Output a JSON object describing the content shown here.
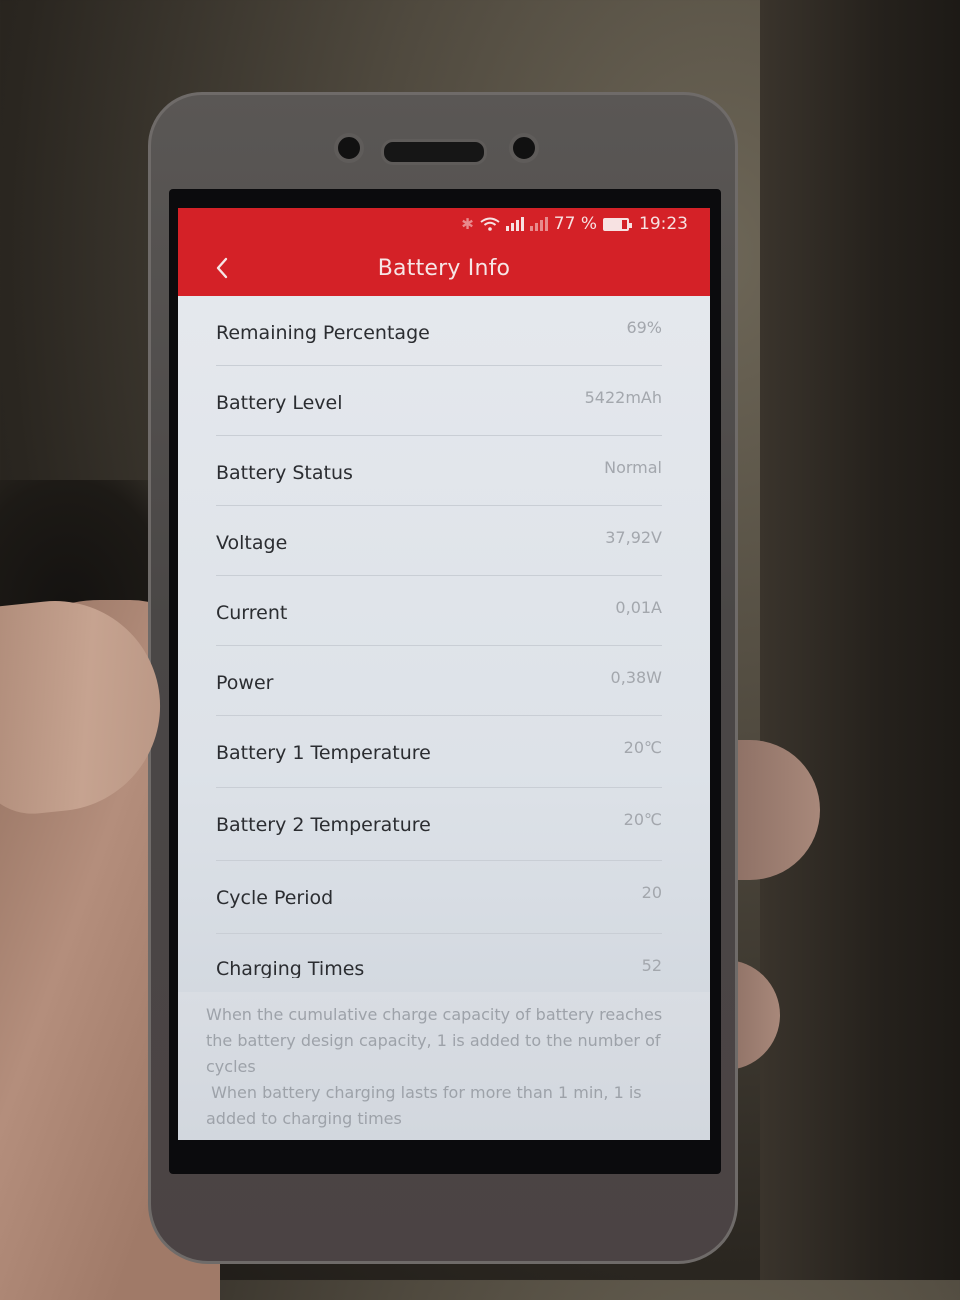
{
  "status_bar": {
    "icons": [
      "bluetooth-icon",
      "wifi-icon",
      "signal-icon",
      "signal-dim-icon",
      "battery-icon"
    ],
    "battery_percent_text": "77 %",
    "battery_level": 0.77,
    "time": "19:23"
  },
  "app_bar": {
    "back_icon": "chevron-left-icon",
    "title": "Battery Info"
  },
  "rows": [
    {
      "label": "Remaining Percentage",
      "value": "69%"
    },
    {
      "label": "Battery Level",
      "value": "5422mAh"
    },
    {
      "label": "Battery Status",
      "value": "Normal"
    },
    {
      "label": "Voltage",
      "value": "37,92V"
    },
    {
      "label": "Current",
      "value": "0,01A"
    },
    {
      "label": "Power",
      "value": "0,38W"
    },
    {
      "label": "Battery 1 Temperature",
      "value": "20℃"
    },
    {
      "label": "Battery 2 Temperature",
      "value": "20℃"
    },
    {
      "label": "Cycle Period",
      "value": "20"
    },
    {
      "label": "Charging Times",
      "value": "52"
    }
  ],
  "footnote": {
    "line1": "When the cumulative charge capacity of battery reaches the battery design capacity, 1 is added to the number of cycles",
    "line2": " When battery charging lasts for more than 1 min, 1 is added to charging times"
  },
  "colors": {
    "accent": "#d42127",
    "background": "#e6e9ee",
    "label_text": "#2b2d31",
    "value_text": "#a3a7ad"
  }
}
